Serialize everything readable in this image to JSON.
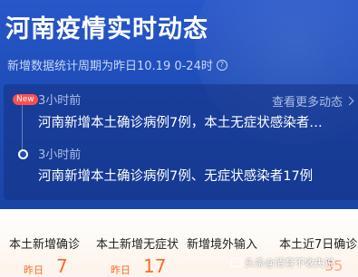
{
  "header": {
    "title": "河南疫情实时动态",
    "subtitle": "新增数据统计周期为昨日10.19 0-24时",
    "info_icon": "info-icon"
  },
  "timeline": {
    "more_link": "查看更多动态",
    "items": [
      {
        "badge": "New",
        "time": "3小时前",
        "text": "河南新增本土确诊病例7例，本土无症状感染者…"
      },
      {
        "time": "3小时前",
        "text": "河南新增本土确诊病例7例、无症状感染者17例"
      }
    ]
  },
  "stats": [
    {
      "label": "本土新增确诊",
      "prefix": "昨日",
      "value": "7"
    },
    {
      "label": "本土新增无症状",
      "prefix": "昨日",
      "value": "17"
    },
    {
      "label": "新增境外输入",
      "prefix": "",
      "value": ""
    },
    {
      "label": "本土近7日确诊",
      "prefix": "",
      "value": "35"
    }
  ],
  "watermark": "头条@清育不收失说",
  "colors": {
    "hero_blue": "#1e4db8",
    "accent_orange": "#ff6a2a",
    "badge_red": "#ff4d4f"
  }
}
